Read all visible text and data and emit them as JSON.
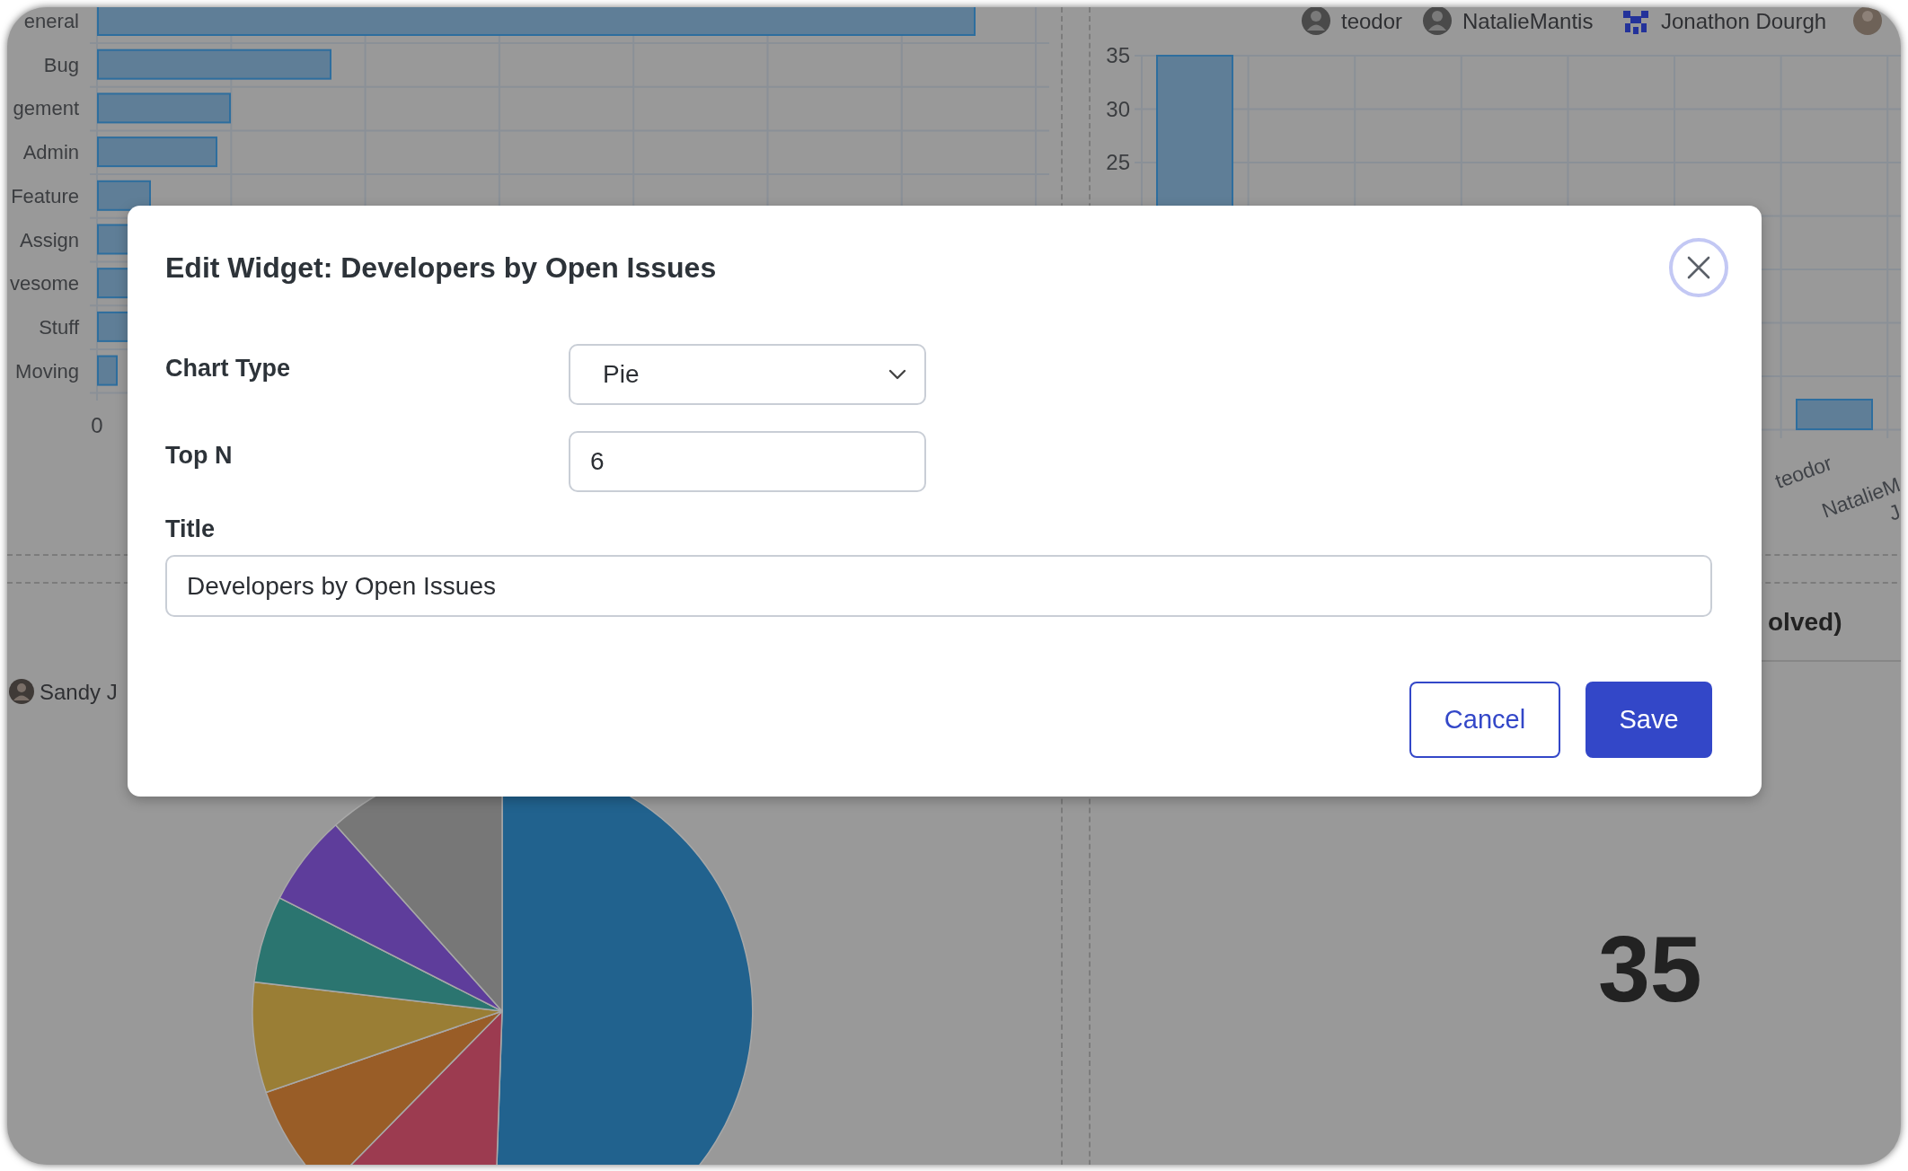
{
  "dashboard": {
    "label_bars": {
      "categories": [
        "eneral",
        "Bug",
        "gement",
        "Admin",
        "Feature",
        "Assign",
        "vesome",
        "Stuff",
        "Moving"
      ],
      "x_tick": "0"
    },
    "developer_bars": {
      "legend": [
        {
          "name": "teodor",
          "kind": "photo"
        },
        {
          "name": "NatalieMantis",
          "kind": "photo"
        },
        {
          "name": "Jonathon Dourgh",
          "kind": "identicon"
        }
      ],
      "y_ticks": [
        "35",
        "30",
        "25"
      ],
      "x_labels": [
        "teodor",
        "NatalieM",
        "J"
      ]
    },
    "developer_pie": {
      "legend": [
        {
          "name": "Sandy J",
          "kind": "photo"
        }
      ]
    },
    "resolved_card": {
      "title": "olved)",
      "value": "35"
    }
  },
  "dialog": {
    "title": "Edit Widget: Developers by Open Issues",
    "fields": [
      {
        "kind": "select",
        "label": "Chart Type",
        "value": "Pie"
      },
      {
        "kind": "number",
        "label": "Top N",
        "value": "6"
      },
      {
        "kind": "text",
        "label": "Title",
        "value": "Developers by Open Issues"
      }
    ],
    "buttons": [
      {
        "kind": "secondary",
        "label": "Cancel"
      },
      {
        "kind": "primary",
        "label": "Save"
      }
    ]
  }
}
